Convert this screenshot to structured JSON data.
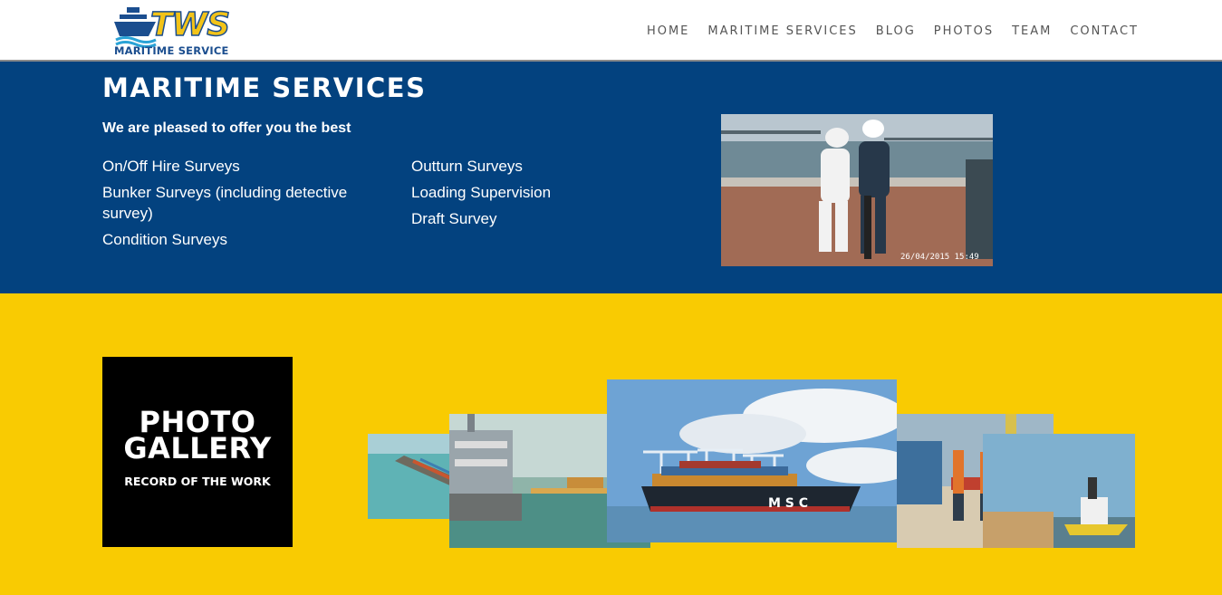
{
  "header": {
    "logo_text": "TWS",
    "logo_subtext": "MARITIME SERVICE",
    "nav": [
      "HOME",
      "MARITIME SERVICES",
      "BLOG",
      "PHOTOS",
      "TEAM",
      "CONTACT"
    ]
  },
  "services": {
    "title": "MARITIME SERVICES",
    "subtitle": "We are pleased to offer you the best",
    "left_items": [
      "On/Off Hire Surveys",
      "Bunker Surveys (including detective survey)",
      "Condition Surveys"
    ],
    "right_items": [
      "Outturn Surveys",
      "Loading Supervision",
      "Draft Survey"
    ],
    "photo_timestamp": "26/04/2015 15:49"
  },
  "gallery": {
    "title": "PHOTO\nGALLERY",
    "subtitle": "RECORD OF THE WORK",
    "ship_lettering": "M S C"
  },
  "colors": {
    "navy": "#03427f",
    "yellow": "#f9cb02",
    "black": "#000000"
  }
}
